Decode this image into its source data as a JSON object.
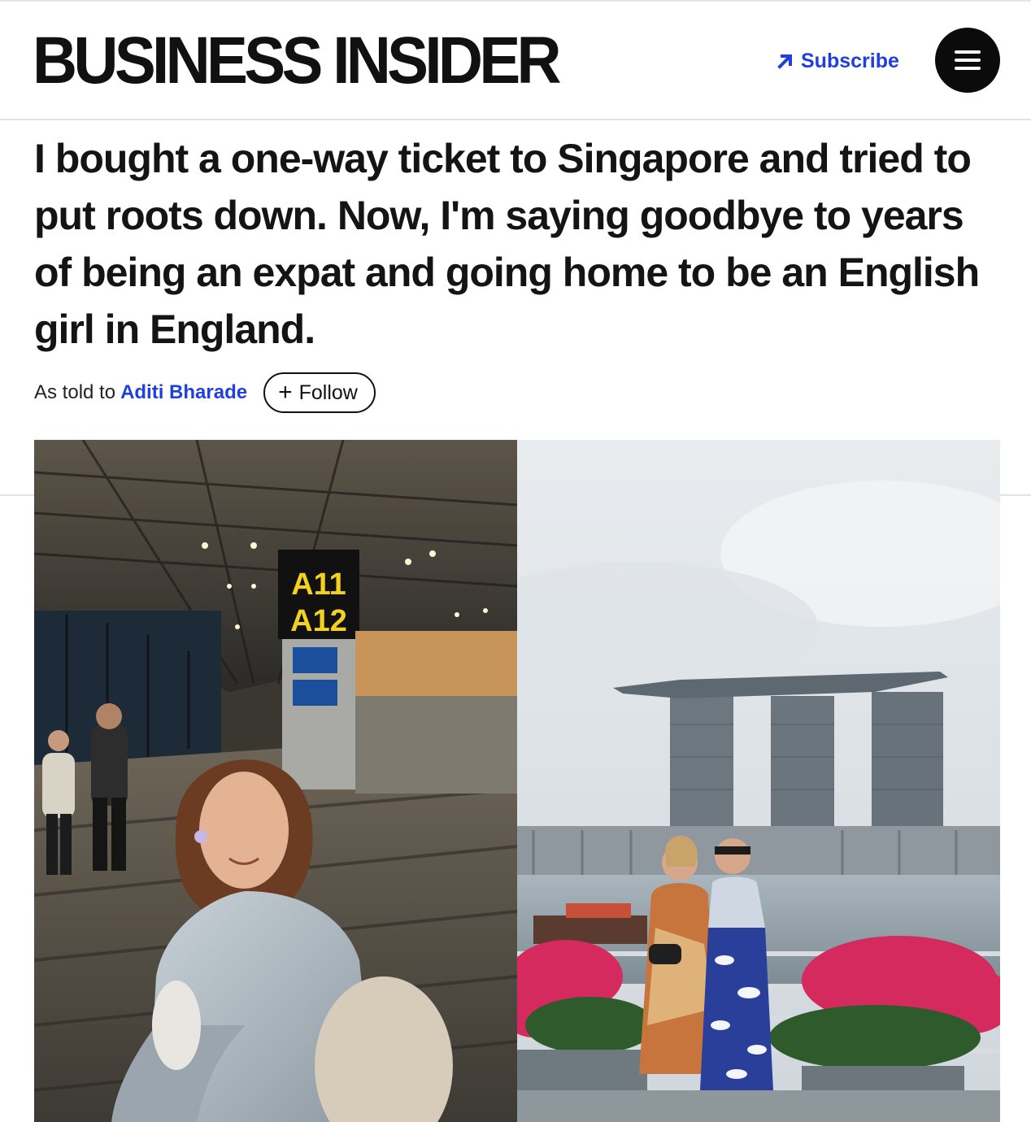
{
  "header": {
    "logo": "BUSINESS INSIDER",
    "subscribe_label": "Subscribe",
    "subscribe_icon": "arrow-up-right-icon",
    "menu_icon": "hamburger-menu-icon"
  },
  "article": {
    "headline": "I bought a one-way ticket to Singapore and tried to put roots down. Now, I'm saying goodbye to years of being an expat and going home to be an English girl in England.",
    "byline_prefix": "As told to",
    "author": "Aditi Bharade",
    "follow_label": "Follow"
  },
  "photos": {
    "left": {
      "gate_sign_line1": "A11",
      "gate_sign_line2": "A12"
    }
  },
  "colors": {
    "accent": "#1f3fe0",
    "text": "#141414",
    "rule": "#e2e2e2"
  }
}
